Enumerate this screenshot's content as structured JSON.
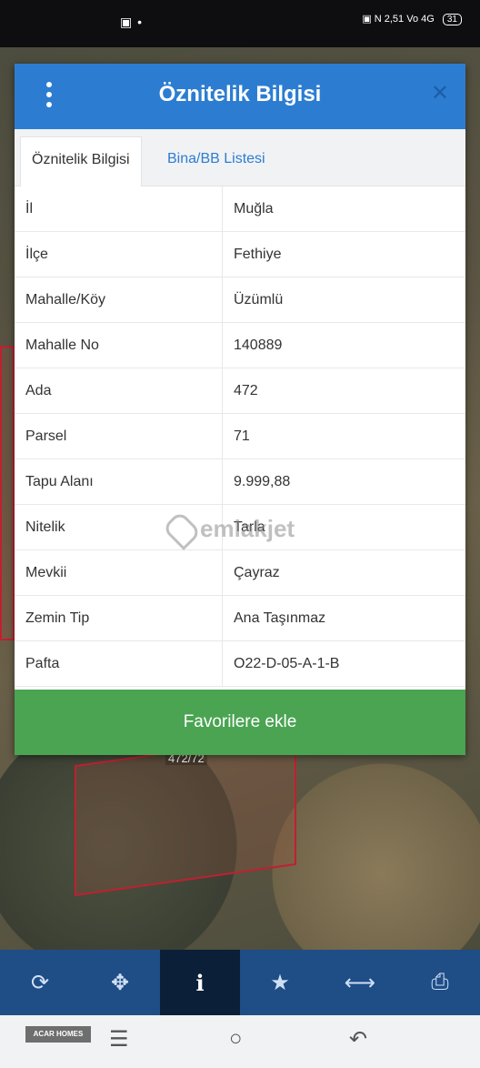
{
  "status_bar": {
    "left_icons": "▣ •",
    "right_text": "▣ N 2,51 Vo 4G",
    "battery": "31"
  },
  "dialog": {
    "title": "Öznitelik Bilgisi",
    "tabs": [
      {
        "label": "Öznitelik Bilgisi",
        "active": true
      },
      {
        "label": "Bina/BB Listesi",
        "active": false
      }
    ],
    "rows": [
      {
        "key": "İl",
        "value": "Muğla"
      },
      {
        "key": "İlçe",
        "value": "Fethiye"
      },
      {
        "key": "Mahalle/Köy",
        "value": "Üzümlü"
      },
      {
        "key": "Mahalle No",
        "value": "140889"
      },
      {
        "key": "Ada",
        "value": "472"
      },
      {
        "key": "Parsel",
        "value": "71"
      },
      {
        "key": "Tapu Alanı",
        "value": "9.999,88"
      },
      {
        "key": "Nitelik",
        "value": "Tarla"
      },
      {
        "key": "Mevkii",
        "value": "Çayraz"
      },
      {
        "key": "Zemin Tip",
        "value": "Ana Taşınmaz"
      },
      {
        "key": "Pafta",
        "value": "O22-D-05-A-1-B"
      }
    ],
    "favorite_button": "Favorilere ekle"
  },
  "watermark": "emlakjet",
  "map_label": "472/72",
  "toolbar": {
    "buttons": [
      {
        "name": "refresh-icon",
        "glyph": "⟳"
      },
      {
        "name": "locate-icon",
        "glyph": "✥"
      },
      {
        "name": "info-icon",
        "glyph": "i"
      },
      {
        "name": "star-icon",
        "glyph": "★"
      },
      {
        "name": "measure-icon",
        "glyph": "⟷"
      },
      {
        "name": "print-icon",
        "glyph": "⎙"
      }
    ]
  },
  "nav_bar": {
    "logo": "ACAR HOMES",
    "menu": "☰",
    "home": "○",
    "back": "↶"
  },
  "colors": {
    "header_blue": "#2c7dd1",
    "button_green": "#4aa452",
    "toolbar_blue": "#1f4d86"
  }
}
